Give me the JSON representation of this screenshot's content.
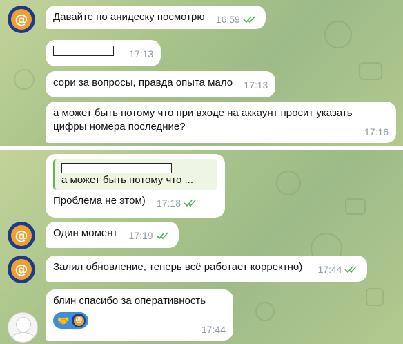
{
  "chat": {
    "top": {
      "messages": [
        {
          "text": "Давайте по анидеску посмотрю",
          "time": "16:59",
          "read": true
        },
        {
          "text": "",
          "redacted": true,
          "time": "17:13"
        },
        {
          "text": "сори за вопросы, правда опыта мало",
          "time": "17:13"
        },
        {
          "line1": "а может быть потому что при входе на аккаунт просит указать",
          "line2": "цифры номера последние?",
          "time": "17:16"
        }
      ]
    },
    "bottom": {
      "messages": [
        {
          "reply_quote": "а может быть потому что ...",
          "text": "Проблема не  этом)",
          "time": "17:18",
          "read": true
        },
        {
          "text": "Один момент",
          "time": "17:19",
          "read": true
        },
        {
          "text": "Залил обновление, теперь всё работает корректно)",
          "time": "17:44",
          "read": true
        },
        {
          "text": "блин спасибо за оперативность",
          "time": "17:44",
          "reaction_emoji": "🤝"
        }
      ]
    }
  },
  "avatars": {
    "bot_glyph": "@"
  },
  "colors": {
    "bubble": "#ffffff",
    "accent_green": "#4caf50",
    "meta_gray": "#8d9aa6",
    "avatar_blue": "#1d3b8c",
    "avatar_orange": "#f0a030",
    "reaction_blue": "#3e8fd6"
  }
}
